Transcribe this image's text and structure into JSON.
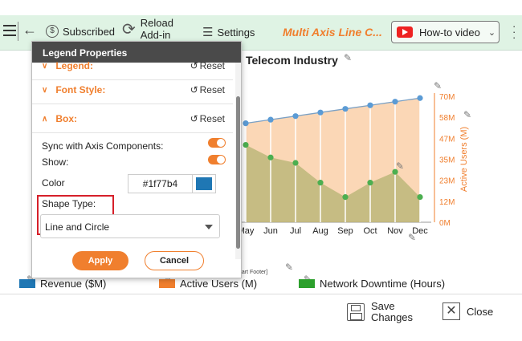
{
  "toolbar": {
    "subscribed_label": "Subscribed",
    "reload_label_line1": "Reload",
    "reload_label_line2": "Add-in",
    "settings_label": "Settings",
    "app_title": "Multi Axis Line C...",
    "howto_label": "How-to video",
    "icons": [
      "menu-icon",
      "back-icon",
      "dollar-icon",
      "reload-icon",
      "settings-icon",
      "youtube-icon",
      "chevron-down-icon",
      "more-icon"
    ]
  },
  "panel": {
    "title": "Legend Properties",
    "sections": [
      {
        "label": "Legend:",
        "reset": "Reset"
      },
      {
        "label": "Font Style:",
        "reset": "Reset"
      },
      {
        "label": "Box:",
        "reset": "Reset"
      }
    ],
    "sync_label": "Sync with Axis Components:",
    "sync_on": true,
    "show_label": "Show:",
    "show_on": true,
    "color_label": "Color",
    "color_value": "#1f77b4",
    "shape_label": "Shape Type:",
    "shape_value": "Line and Circle",
    "apply_label": "Apply",
    "cancel_label": "Cancel"
  },
  "chart": {
    "title": "Telecom Industry",
    "footer": "[Chart Footer]",
    "right_axis_label": "Active Users (M)",
    "legend": [
      {
        "label": "Revenue ($M)",
        "color": "#1f77b4"
      },
      {
        "label": "Active Users (M)",
        "color": "#f07f2e"
      },
      {
        "label": "Network Downtime (Hours)",
        "color": "#2ca02c"
      }
    ]
  },
  "chart_data": {
    "type": "line",
    "title": "Telecom Industry",
    "categories": [
      "May",
      "Jun",
      "Jul",
      "Aug",
      "Sep",
      "Oct",
      "Nov",
      "Dec"
    ],
    "right_axis": {
      "label": "Active Users (M)",
      "ticks": [
        "0M",
        "12M",
        "23M",
        "35M",
        "47M",
        "58M",
        "70M"
      ],
      "range": [
        0,
        70
      ]
    },
    "series": [
      {
        "name": "Revenue ($M)",
        "color": "#1f77b4",
        "values": [
          55,
          57,
          59,
          61,
          63,
          65,
          67,
          69
        ]
      },
      {
        "name": "Active Users (M)",
        "color": "#f07f2e",
        "area": true,
        "values": [
          55,
          57,
          59,
          61,
          63,
          65,
          67,
          69
        ]
      },
      {
        "name": "Network Downtime (Hours)",
        "color": "#2ca02c",
        "area": true,
        "values": [
          43,
          36,
          33,
          22,
          14,
          22,
          28,
          14
        ]
      }
    ]
  },
  "bottom": {
    "save_line1": "Save",
    "save_line2": "Changes",
    "close_label": "Close"
  }
}
